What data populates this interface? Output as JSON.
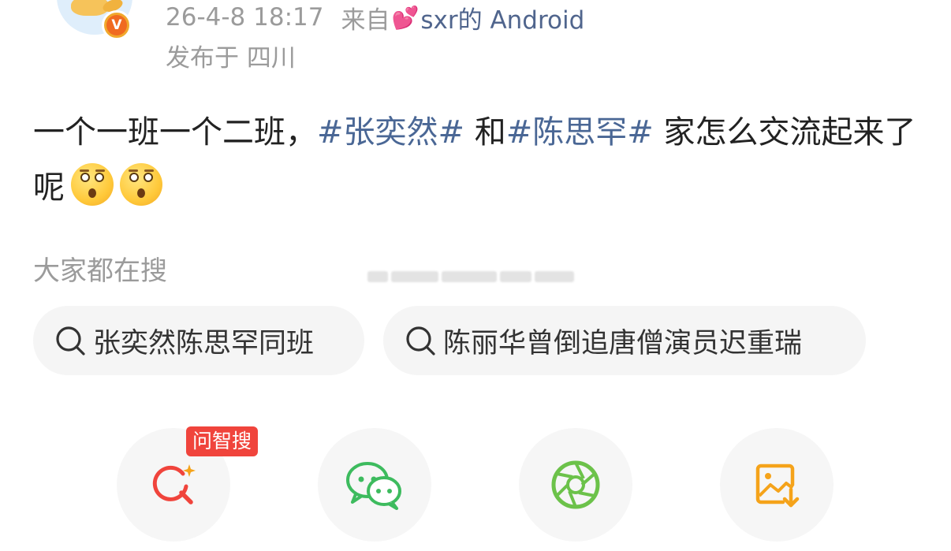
{
  "header": {
    "timestamp": "26-4-8 18:17",
    "source_prefix": "来自",
    "source_emoji": "💕",
    "source_device": "sxr的 Android",
    "location": "发布于 四川",
    "verified_badge": "V"
  },
  "post": {
    "text_1": "一个一班一个二班，",
    "topic_1": "#张奕然#",
    "text_2": " 和",
    "topic_2": "#陈思罕#",
    "text_3": " 家怎么交流起来了呢",
    "emoji_name": "flushed-face-emoji"
  },
  "search": {
    "label": "大家都在搜",
    "chips": [
      {
        "label": "张奕然陈思罕同班"
      },
      {
        "label": "陈丽华曾倒追唐僧演员迟重瑞"
      }
    ]
  },
  "actions": {
    "wenzhisou_tag": "问智搜",
    "items": [
      {
        "icon": "ai-search-icon",
        "color": "#f0443c"
      },
      {
        "icon": "wechat-icon",
        "color": "#3dbb5e"
      },
      {
        "icon": "moments-shutter-icon",
        "color": "#6cc24a"
      },
      {
        "icon": "save-image-icon",
        "color": "#f5a31a"
      }
    ]
  },
  "colors": {
    "topic": "#4a6795",
    "meta_text": "#9b9b9b",
    "body_text": "#222222"
  }
}
